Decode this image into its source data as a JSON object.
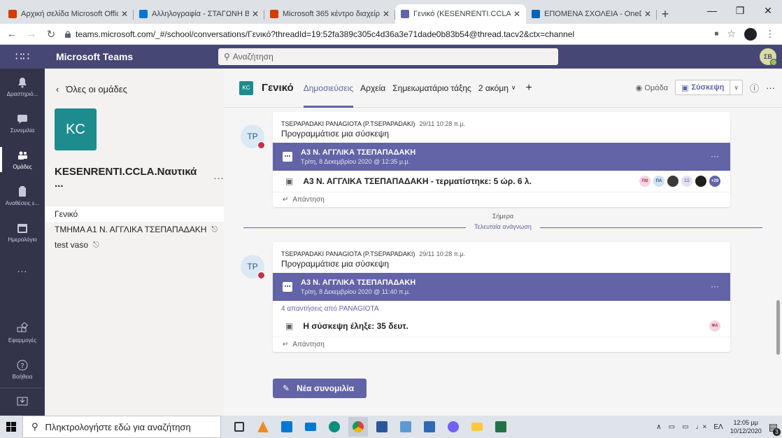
{
  "browser": {
    "tabs": [
      {
        "label": "Αρχική σελίδα Microsoft Office",
        "color": "#d83b01",
        "active": false
      },
      {
        "label": "Αλληλογραφία - ΣΤΑΓΩΝΗ ΒΑ",
        "color": "#0078d4",
        "active": false
      },
      {
        "label": "Microsoft 365 κέντρο διαχείρι",
        "color": "#d83b01",
        "active": false
      },
      {
        "label": "Γενικό (KESENRENTI.CCLA.Ναυ",
        "color": "#6264a7",
        "active": true
      },
      {
        "label": "ΕΠΟΜΕΝΑ ΣΧΟΛΕΙΑ - OneDriv",
        "color": "#0364b8",
        "active": false
      }
    ],
    "new_tab": "+",
    "url": "teams.microsoft.com/_#/school/conversations/Γενικό?threadId=19:52fa389c305c4d36a3e71dade0b83b54@thread.tacv2&ctx=channel"
  },
  "teams": {
    "app_title": "Microsoft Teams",
    "search_placeholder": "Αναζήτηση",
    "me_initials": "ΣΒ"
  },
  "rail": {
    "items": [
      {
        "label": "Δραστηριό...",
        "icon": "bell-icon",
        "active": false
      },
      {
        "label": "Συνομιλία",
        "icon": "chat-icon",
        "active": false
      },
      {
        "label": "Ομάδες",
        "icon": "teams-icon",
        "active": true
      },
      {
        "label": "Αναθέσεις ε...",
        "icon": "assignments-icon",
        "active": false
      },
      {
        "label": "Ημερολόγιο",
        "icon": "calendar-icon",
        "active": false
      },
      {
        "label": "...",
        "icon": "more-icon",
        "active": false
      }
    ],
    "apps_label": "Εφαρμογές",
    "help_label": "Βοήθεια"
  },
  "panel": {
    "back_label": "Όλες οι ομάδες",
    "team_initials": "KC",
    "team_name": "KESENRENTI.CCLA.Ναυτικά ...",
    "more": "···",
    "channels": [
      {
        "name": "Γενικό",
        "active": true,
        "locked": false
      },
      {
        "name": "ΤΜΗΜΑ Α1 Ν. ΑΓΓΛΙΚΑ ΤΣΕΠΑΠΑΔΑΚΗ",
        "active": false,
        "locked": true
      },
      {
        "name": "test vaso",
        "active": false,
        "locked": true
      }
    ]
  },
  "channel": {
    "icon_initials": "KC",
    "name": "Γενικό",
    "tabs": [
      {
        "label": "Δημοσιεύσεις",
        "active": true
      },
      {
        "label": "Αρχεία",
        "active": false
      },
      {
        "label": "Σημειωματάριο τάξης",
        "active": false
      },
      {
        "label": "2 ακόμη",
        "active": false
      }
    ],
    "team_label": "Ομάδα",
    "meet_label": "Σύσκεψη",
    "info": "ⓘ",
    "more": "···"
  },
  "posts": [
    {
      "avatar": "TP",
      "author": "TSEPAPADAKI PANAGIOTA (P.TSEPAPADAKI)",
      "time": "29/11 10:28 π.μ.",
      "subtitle": "Προγραμμάτισε μια σύσκεψη",
      "meeting_title": "Α3 Ν. ΑΓΓΛΙΚΑ ΤΣΕΠΑΠΑΔΑΚΗ",
      "meeting_date": "Τρίτη, 8 Δεκεμβρίου 2020 @ 12:35 μ.μ.",
      "replies_link": "",
      "row_text": "Α3 Ν. ΑΓΓΛΙΚΑ ΤΣΕΠΑΠΑΔΑΚΗ - τερματίστηκε: 5 ώρ. 6 λ.",
      "participants": [
        {
          "initials": "ΠΘ",
          "bg": "#f4d3e3",
          "fg": "#a4373a"
        },
        {
          "initials": "ΠΑ",
          "bg": "#cfe0f3",
          "fg": "#2b5a87"
        },
        {
          "initials": "",
          "bg": "#3b3a39",
          "fg": "#fff"
        },
        {
          "initials": "ΞΞ",
          "bg": "#e8e0f0",
          "fg": "#6264a7"
        },
        {
          "initials": "",
          "bg": "#201f1e",
          "fg": "#fff"
        },
        {
          "initials": "+29",
          "bg": "#6264a7",
          "fg": "#fff"
        }
      ],
      "reply_label": "Απάντηση"
    },
    {
      "avatar": "TP",
      "author": "TSEPAPADAKI PANAGIOTA (P.TSEPAPADAKI)",
      "time": "29/11 10:28 π.μ.",
      "subtitle": "Προγραμμάτισε μια σύσκεψη",
      "meeting_title": "Α3 Ν. ΑΓΓΛΙΚΑ ΤΣΕΠΑΠΑΔΑΚΗ",
      "meeting_date": "Τρίτη, 8 Δεκεμβρίου 2020 @ 11:40 π.μ.",
      "replies_link": "4 απαντήσεις από PANAGIOTA",
      "row_text": "Η σύσκεψη έληξε: 35 δευτ.",
      "participants": [
        {
          "initials": "ΦΑ",
          "bg": "#f4d3e3",
          "fg": "#a4373a"
        }
      ],
      "reply_label": "Απάντηση"
    }
  ],
  "divider": {
    "today": "Σήμερα",
    "last_read": "Τελευταία ανάγνωση"
  },
  "new_conversation": "Νέα συνομιλία",
  "taskbar": {
    "search_placeholder": "Πληκτρολογήστε εδώ για αναζήτηση",
    "lang": "ΕΛ",
    "time": "12:05 μμ",
    "date": "10/12/2020",
    "notifications": "3"
  }
}
